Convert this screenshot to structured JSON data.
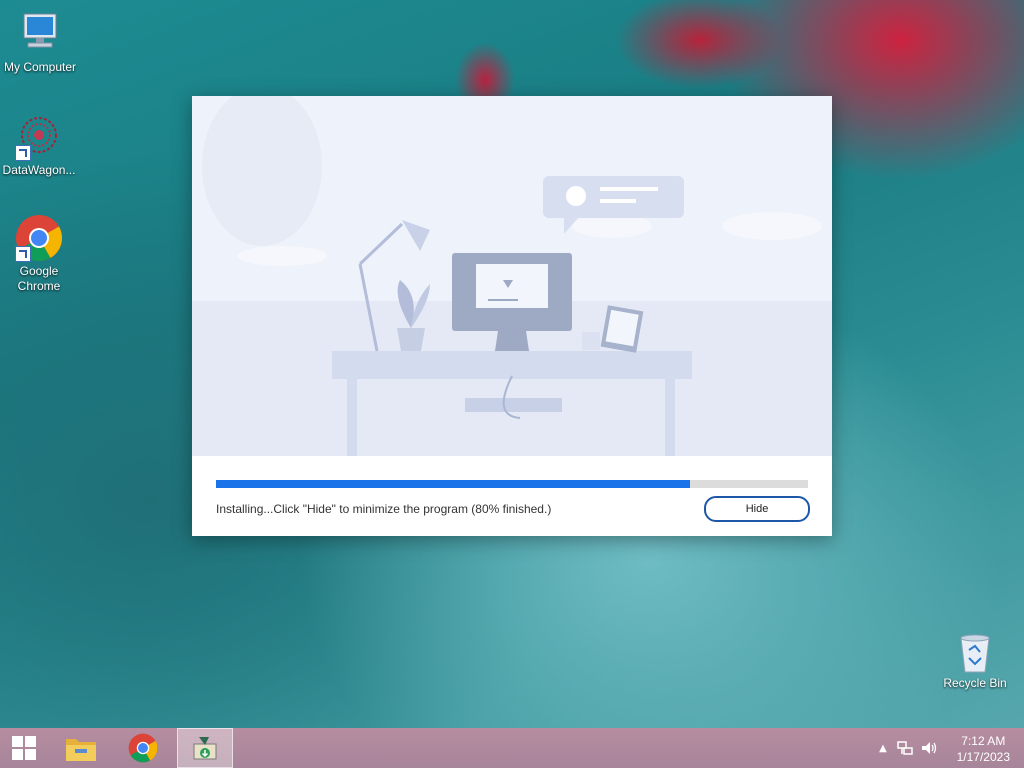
{
  "desktop": {
    "icons": [
      {
        "label": "My Computer"
      },
      {
        "label": "DataWagon..."
      },
      {
        "label": "Google Chrome"
      },
      {
        "label": "Recycle Bin"
      }
    ]
  },
  "installer": {
    "status_text": "Installing...Click \"Hide\" to minimize the program (80% finished.)",
    "progress": 0.8,
    "hide_label": "Hide"
  },
  "taskbar": {
    "items": [
      "start-icon",
      "file-explorer-icon",
      "chrome-icon",
      "installer-icon"
    ],
    "tray_icons": [
      "show-hidden-icons-icon",
      "network-icon",
      "volume-icon"
    ],
    "clock": {
      "time": "7:12 AM",
      "date": "1/17/2023"
    }
  },
  "colors": {
    "accent": "#1a73e8",
    "button_border": "#1e56a8"
  }
}
